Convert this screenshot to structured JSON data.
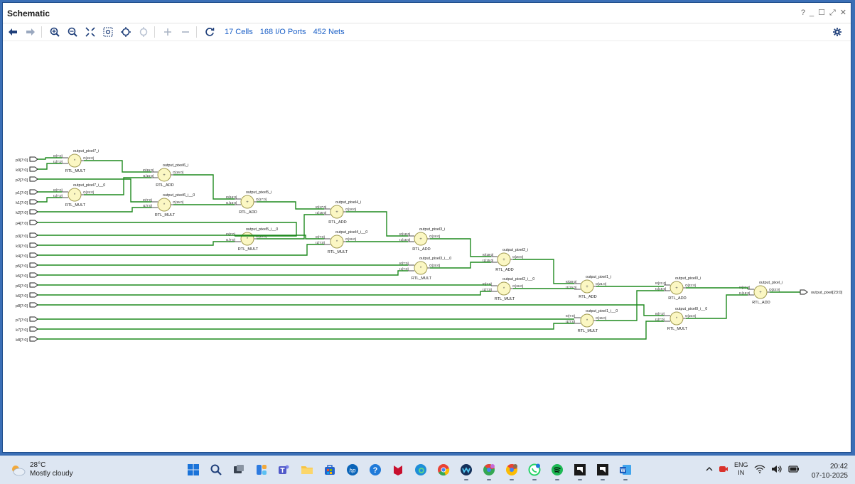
{
  "window": {
    "title": "Schematic",
    "controls": [
      "?",
      "_",
      "☐",
      "⤢",
      "✕"
    ]
  },
  "toolbar": {
    "cells": "17 Cells",
    "io_ports": "168 I/O Ports",
    "nets": "452 Nets",
    "tools": [
      "back-icon",
      "forward-icon",
      "zoom-in-icon",
      "zoom-out-icon",
      "fit-icon",
      "zoom-area-icon",
      "select-icon",
      "deselect-icon",
      "add-icon",
      "remove-icon",
      "refresh-icon",
      "gear-icon"
    ]
  },
  "schematic": {
    "inputs": [
      "p0[7:0]",
      "k0[7:0]",
      "p2[7:0]",
      "p1[7:0]",
      "k1[7:0]",
      "k2[7:0]",
      "p4[7:0]",
      "p3[7:0]",
      "k3[7:0]",
      "k4[7:0]",
      "p5[7:0]",
      "k5[7:0]",
      "p6[7:0]",
      "k6[7:0]",
      "p8[7:0]",
      "p7[7:0]",
      "k7[7:0]",
      "k8[7:0]"
    ],
    "output": "output_pixel[23:0]",
    "cells": [
      {
        "name": "output_pixel7_i",
        "type": "RTL_MULT",
        "pins": [
          "I0[7:0]",
          "I1[7:0]",
          "O[15:0]"
        ]
      },
      {
        "name": "output_pixel7_i__0",
        "type": "RTL_MULT",
        "pins": [
          "I0[7:0]",
          "I1[7:0]",
          "O[15:0]"
        ]
      },
      {
        "name": "output_pixel6_i",
        "type": "RTL_ADD",
        "pins": [
          "I0[15:0]",
          "I1[15:0]",
          "O[16:0]"
        ]
      },
      {
        "name": "output_pixel6_i__0",
        "type": "RTL_MULT",
        "pins": [
          "I0[7:0]",
          "I1[7:0]",
          "O[15:0]"
        ]
      },
      {
        "name": "output_pixel5_i",
        "type": "RTL_ADD",
        "pins": [
          "I0[16:0]",
          "I1[15:0]",
          "O[17:0]"
        ]
      },
      {
        "name": "output_pixel5_i__0",
        "type": "RTL_MULT",
        "pins": [
          "I0[7:0]",
          "I1[7:0]",
          "O[15:0]"
        ]
      },
      {
        "name": "output_pixel4_i",
        "type": "RTL_ADD",
        "pins": [
          "I0[17:0]",
          "I1[15:0]",
          "O[18:0]"
        ]
      },
      {
        "name": "output_pixel4_i__0",
        "type": "RTL_MULT",
        "pins": [
          "I0[7:0]",
          "I1[7:0]",
          "O[15:0]"
        ]
      },
      {
        "name": "output_pixel3_i",
        "type": "RTL_ADD",
        "pins": [
          "I0[18:0]",
          "I1[15:0]",
          "O[19:0]"
        ]
      },
      {
        "name": "output_pixel3_i__0",
        "type": "RTL_MULT",
        "pins": [
          "I0[7:0]",
          "I1[7:0]",
          "O[15:0]"
        ]
      },
      {
        "name": "output_pixel2_i",
        "type": "RTL_ADD",
        "pins": [
          "I0[19:0]",
          "I1[15:0]",
          "O[20:0]"
        ]
      },
      {
        "name": "output_pixel2_i__0",
        "type": "RTL_MULT",
        "pins": [
          "I0[7:0]",
          "I1[7:0]",
          "O[15:0]"
        ]
      },
      {
        "name": "output_pixel1_i",
        "type": "RTL_ADD",
        "pins": [
          "I0[20:0]",
          "I1[15:0]",
          "O[21:0]"
        ]
      },
      {
        "name": "output_pixel1_i__0",
        "type": "RTL_MULT",
        "pins": [
          "I0[7:0]",
          "I1[7:0]",
          "O[15:0]"
        ]
      },
      {
        "name": "output_pixel0_i",
        "type": "RTL_ADD",
        "pins": [
          "I0[21:0]",
          "I1[15:0]",
          "O[22:0]"
        ]
      },
      {
        "name": "output_pixel0_i__0",
        "type": "RTL_MULT",
        "pins": [
          "I0[7:0]",
          "I1[7:0]",
          "O[15:0]"
        ]
      },
      {
        "name": "output_pixel_i",
        "type": "RTL_ADD",
        "pins": [
          "I0[22:0]",
          "I1[15:0]",
          "O[23:0]"
        ]
      }
    ]
  },
  "taskbar": {
    "weather_temp": "28°C",
    "weather_desc": "Mostly cloudy",
    "apps": [
      "windows-start-icon",
      "search-icon",
      "task-view-icon",
      "widgets-icon",
      "teams-icon",
      "file-explorer-icon",
      "store-icon",
      "hp-icon",
      "support-icon",
      "mcafee-icon",
      "edge-icon",
      "chrome-icon",
      "webex-icon",
      "chrome-profile-icon",
      "chrome-profile2-icon",
      "whatsapp-icon",
      "spotify-icon",
      "vivado-icon",
      "vivado2-icon",
      "word-icon"
    ],
    "lang_line1": "ENG",
    "lang_line2": "IN",
    "time": "20:42",
    "date": "07-10-2025",
    "colors": {
      "wire": "#1f8a1f",
      "cell_fill": "#fbf7c3",
      "cell_stroke": "#a09a50",
      "link": "#1a5fc7"
    }
  }
}
